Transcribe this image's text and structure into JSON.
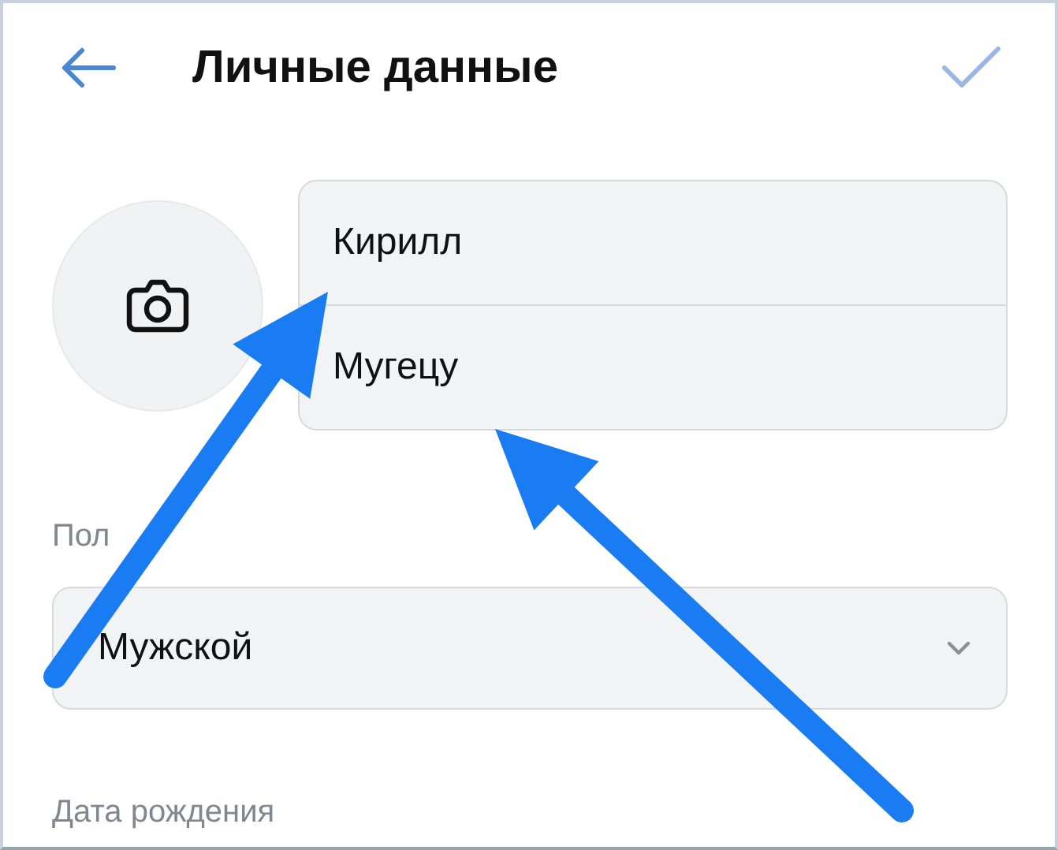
{
  "header": {
    "title": "Личные данные"
  },
  "name_fields": [
    {
      "value": "Кирилл"
    },
    {
      "value": "Мугецу"
    }
  ],
  "gender": {
    "label": "Пол",
    "value": "Мужской"
  },
  "birthday": {
    "label": "Дата рождения"
  },
  "annotations": [
    {
      "kind": "arrow"
    },
    {
      "kind": "arrow"
    }
  ]
}
